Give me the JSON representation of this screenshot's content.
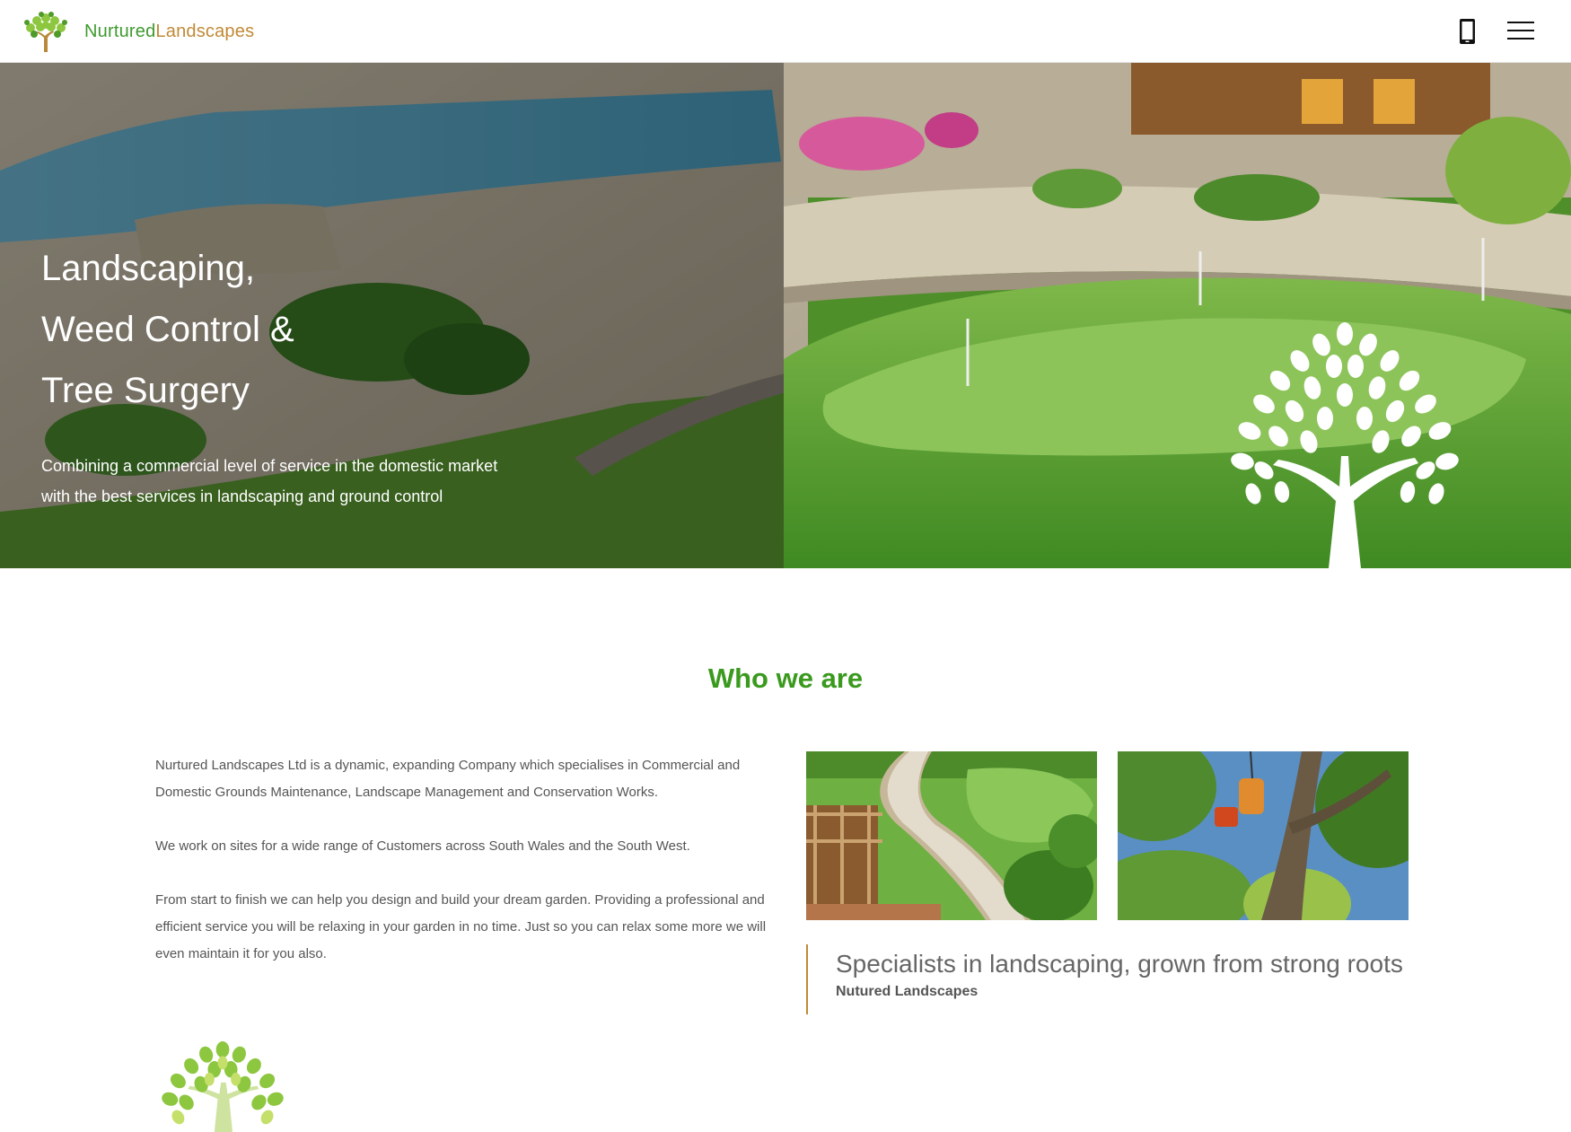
{
  "header": {
    "brand_part1": "Nurtured",
    "brand_part2": "Landscapes",
    "phone_icon": "mobile-phone-icon",
    "menu_icon": "hamburger-menu-icon"
  },
  "hero": {
    "title_lines": [
      "Landscaping,",
      "Weed Control &",
      "Tree Surgery"
    ],
    "subtitle_line1": "Combining a commercial level of service in the domestic market",
    "subtitle_line2": "with the best services in landscaping and ground control"
  },
  "about": {
    "heading": "Who we are",
    "paragraph1": "Nurtured Landscapes Ltd is a dynamic, expanding Company which specialises in Commercial and Domestic Grounds Maintenance, Landscape Management and Conservation Works.",
    "paragraph2": "We work on sites for a wide range of Customers across South Wales and the South West.",
    "paragraph3": "From start to finish we can help you design and build your dream garden. Providing a professional and efficient service you will be relaxing in your garden in no time. Just so you can relax some more we will even maintain it for you also.",
    "quote": "Specialists in landscaping, grown from strong roots",
    "quote_author": "Nutured Landscapes"
  },
  "colors": {
    "brand_green": "#3a9a1e",
    "brand_gold": "#c08a36"
  }
}
